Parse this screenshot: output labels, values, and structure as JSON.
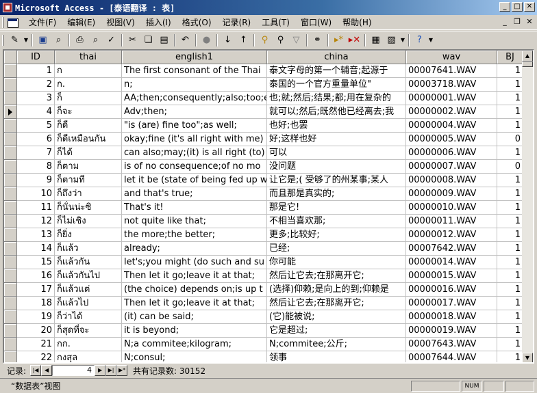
{
  "window": {
    "title": "Microsoft Access - [泰语翻译 : 表]"
  },
  "menu": [
    "文件(F)",
    "编辑(E)",
    "视图(V)",
    "插入(I)",
    "格式(O)",
    "记录(R)",
    "工具(T)",
    "窗口(W)",
    "帮助(H)"
  ],
  "columns": [
    "ID",
    "thai",
    "english1",
    "china",
    "wav",
    "BJ"
  ],
  "rows": [
    {
      "id": "1",
      "thai": "ก",
      "english1": "The first consonant of the Thai",
      "china": "泰文字母的第一个辅音;起源于",
      "wav": "00007641.WAV",
      "bj": "1"
    },
    {
      "id": "2",
      "thai": "ก.",
      "english1": "n;",
      "china": "泰国的一个官方重量单位\"",
      "wav": "00003718.WAV",
      "bj": "1"
    },
    {
      "id": "3",
      "thai": "ก็",
      "english1": "AA;then;consequently;also;too;e",
      "china": "也;就;然后;结果;都;用在复杂的",
      "wav": "00000001.WAV",
      "bj": "1"
    },
    {
      "id": "4",
      "thai": "ก็จะ",
      "english1": "Adv;then;",
      "china": "就可以;然后;既然他已经离去;我",
      "wav": "00000002.WAV",
      "bj": "1"
    },
    {
      "id": "5",
      "thai": "ก็ดี",
      "english1": "\"is (are) fine too\";as well;",
      "china": "也好;也罢",
      "wav": "00000004.WAV",
      "bj": "1"
    },
    {
      "id": "6",
      "thai": "ก็ดีเหมือนกัน",
      "english1": "okay;fine (it's all right with me)",
      "china": "好;这样也好",
      "wav": "00000005.WAV",
      "bj": "0"
    },
    {
      "id": "7",
      "thai": "ก็ได้",
      "english1": "can also;may;(it) is all right (to)",
      "china": "可以",
      "wav": "00000006.WAV",
      "bj": "1"
    },
    {
      "id": "8",
      "thai": "ก็ตาม",
      "english1": "is of no consequence;of no mo",
      "china": "没问题",
      "wav": "00000007.WAV",
      "bj": "0"
    },
    {
      "id": "9",
      "thai": "ก็ตามที",
      "english1": "let it be (state of being fed up w",
      "china": "让它是;( 受够了的州某事;某人",
      "wav": "00000008.WAV",
      "bj": "1"
    },
    {
      "id": "10",
      "thai": "ก็ถึงว่า",
      "english1": "and that's true;",
      "china": "而且那是真实的;",
      "wav": "00000009.WAV",
      "bj": "1"
    },
    {
      "id": "11",
      "thai": "ก็นั่นน่ะซิ",
      "english1": "That's it!",
      "china": "那是它!",
      "wav": "00000010.WAV",
      "bj": "1"
    },
    {
      "id": "12",
      "thai": "ก็ไม่เชิง",
      "english1": "not quite like that;",
      "china": "不相当喜欢那;",
      "wav": "00000011.WAV",
      "bj": "1"
    },
    {
      "id": "13",
      "thai": "ก็ยิ่ง",
      "english1": "the more;the better;",
      "china": "更多;比较好;",
      "wav": "00000012.WAV",
      "bj": "1"
    },
    {
      "id": "14",
      "thai": "ก็แล้ว",
      "english1": "already;",
      "china": "已经;",
      "wav": "00007642.WAV",
      "bj": "1"
    },
    {
      "id": "15",
      "thai": "ก็แล้วกัน",
      "english1": "let's;you might (do such and su",
      "china": "你可能",
      "wav": "00000014.WAV",
      "bj": "1"
    },
    {
      "id": "16",
      "thai": "ก็แล้วกันไป",
      "english1": "Then let it go;leave it at that;",
      "china": "然后让它去;在那离开它;",
      "wav": "00000015.WAV",
      "bj": "1"
    },
    {
      "id": "17",
      "thai": "ก็แล้วแต่",
      "english1": "(the choice) depends on;is up t",
      "china": "(选择)仰赖;是向上的到;仰赖是",
      "wav": "00000016.WAV",
      "bj": "1"
    },
    {
      "id": "18",
      "thai": "ก็แล้วไป",
      "english1": "Then let it go;leave it at that;",
      "china": "然后让它去;在那离开它;",
      "wav": "00000017.WAV",
      "bj": "1"
    },
    {
      "id": "19",
      "thai": "ก็ว่าได้",
      "english1": "(it) can be said;",
      "china": "(它)能被说;",
      "wav": "00000018.WAV",
      "bj": "1"
    },
    {
      "id": "20",
      "thai": "ก็สุดที่จะ",
      "english1": "it is beyond;",
      "china": "它是超过;",
      "wav": "00000019.WAV",
      "bj": "1"
    },
    {
      "id": "21",
      "thai": "กก.",
      "english1": "N;a commitee;kilogram;",
      "china": "N;commitee;公斤;",
      "wav": "00007643.WAV",
      "bj": "1"
    },
    {
      "id": "22",
      "thai": "กงสุล",
      "english1": "N;consul;",
      "china": "领事",
      "wav": "00007644.WAV",
      "bj": "1"
    }
  ],
  "current_row": 4,
  "nav": {
    "label": "记录:",
    "current": "4",
    "total_text": "共有记录数: 30152"
  },
  "status": {
    "view": "“数据表”视图",
    "num": "NUM"
  }
}
